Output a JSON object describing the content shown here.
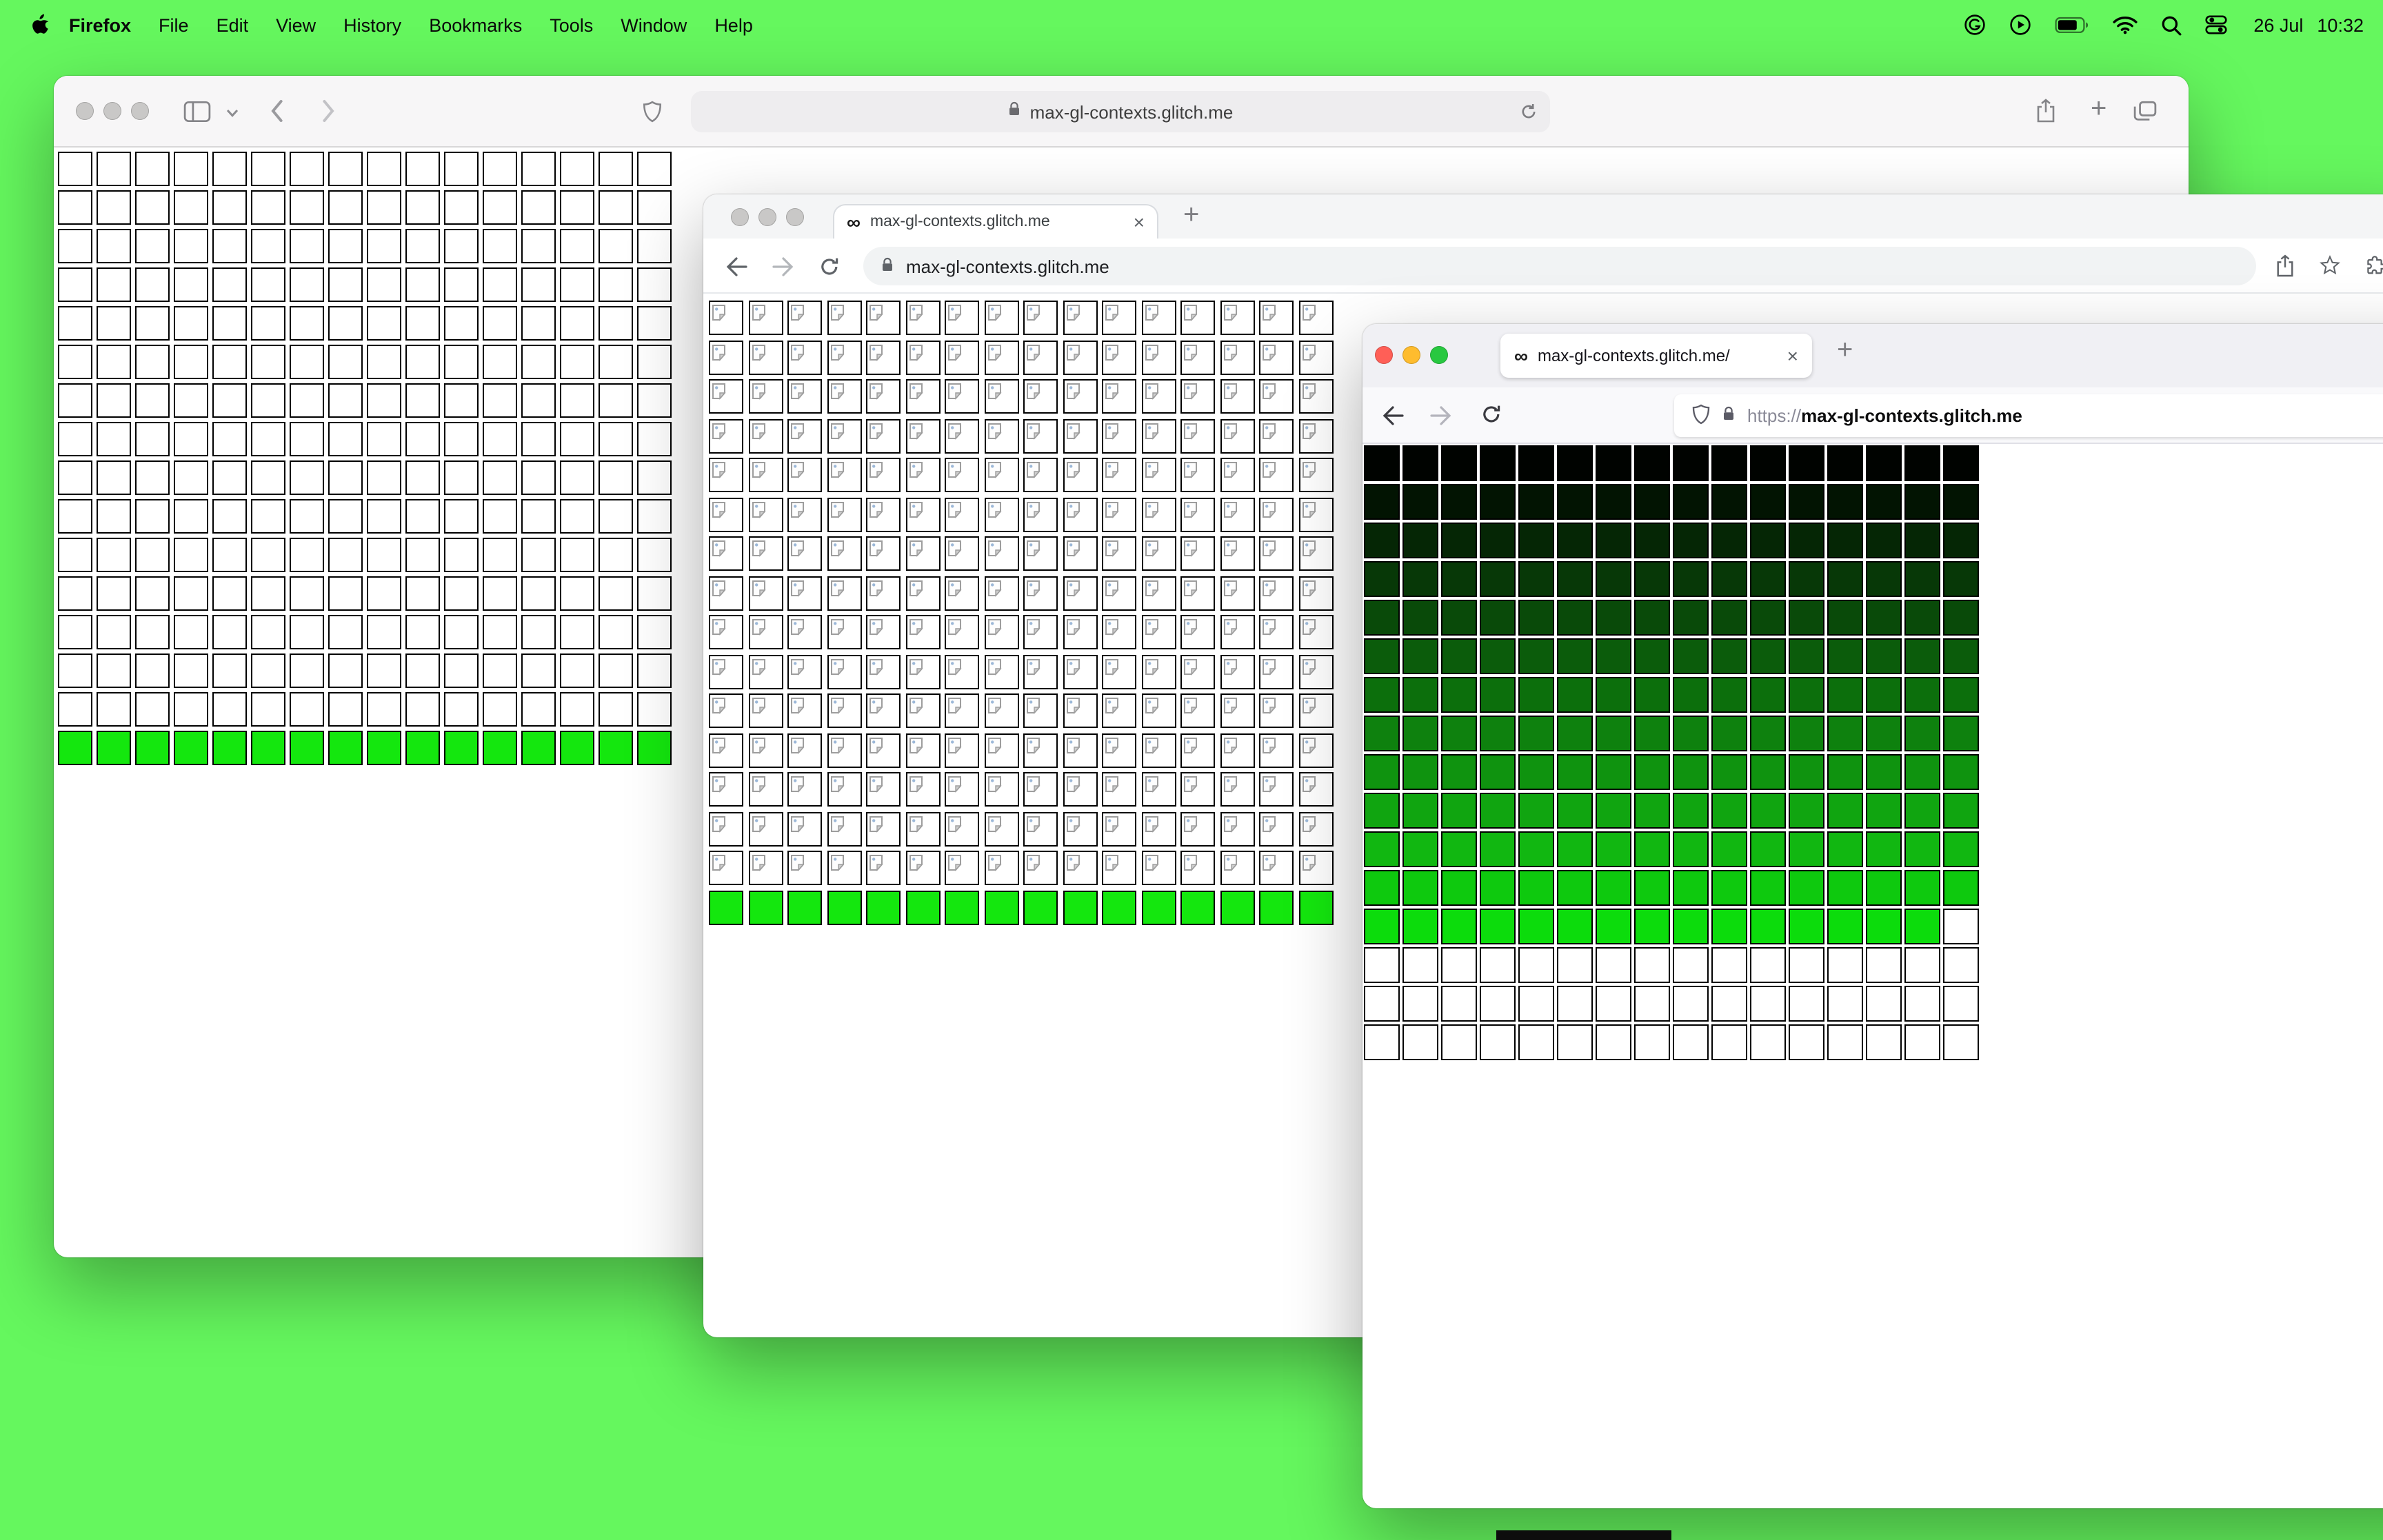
{
  "glyphs": {
    "close": "×",
    "plus": "+"
  },
  "desktop": {
    "background": "#65f75e",
    "accent_green": "#14e70e"
  },
  "menu_bar": {
    "app_name": "Firefox",
    "menus": [
      "File",
      "Edit",
      "View",
      "History",
      "Bookmarks",
      "Tools",
      "Window",
      "Help"
    ],
    "date": "26 Jul",
    "time": "10:32"
  },
  "safari_window": {
    "url": "max-gl-contexts.glitch.me",
    "grid": {
      "cols": 16,
      "cell": 25,
      "gap": 3,
      "border": "#000000",
      "rows": [
        {
          "repeat": 15,
          "fill": "#ffffff"
        },
        {
          "fill": "#14e70e"
        }
      ]
    }
  },
  "chrome_window": {
    "favicon": "∞",
    "tab_title": "max-gl-contexts.glitch.me",
    "url": "max-gl-contexts.glitch.me",
    "grid": {
      "cols": 16,
      "cell": 25,
      "gap": 3.5,
      "border": "#000000",
      "rows": [
        {
          "repeat": 15,
          "fill": "#ffffff",
          "icon": "broken-image"
        },
        {
          "fill": "#14e70e"
        }
      ]
    }
  },
  "firefox_window": {
    "favicon": "∞",
    "tab_title": "max-gl-contexts.glitch.me/",
    "url_scheme": "https://",
    "url_host": "max-gl-contexts.glitch.me",
    "grid": {
      "cols": 16,
      "cell": 26,
      "gap": 2,
      "border": "#000000",
      "rows": [
        {
          "fill": "#000300"
        },
        {
          "fill": "#021402"
        },
        {
          "fill": "#052605"
        },
        {
          "fill": "#073807"
        },
        {
          "fill": "#094a09"
        },
        {
          "fill": "#0b5c0b"
        },
        {
          "fill": "#0c6f0c"
        },
        {
          "fill": "#0e810e"
        },
        {
          "fill": "#0f930f"
        },
        {
          "fill": "#10a510"
        },
        {
          "fill": "#11b711"
        },
        {
          "fill": "#0ec90e"
        },
        {
          "fill": "#0cdc0c"
        },
        {
          "repeat": 3,
          "fill": "#ffffff"
        }
      ],
      "overrides": [
        {
          "row": 12,
          "col": 15,
          "fill": "#ffffff"
        }
      ]
    }
  }
}
